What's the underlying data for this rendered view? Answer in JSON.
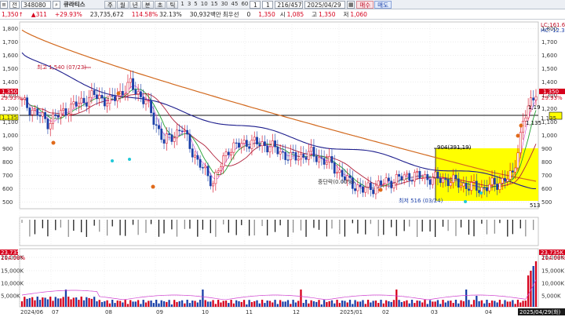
{
  "toolbar": {
    "menu_icon": "menu-icon",
    "mode": "전",
    "code": "348080",
    "search_icon": "search-icon",
    "name": "큐라티스",
    "periods": [
      "주",
      "월",
      "년",
      "분",
      "초",
      "틱"
    ],
    "intervals": [
      "1",
      "3",
      "5",
      "10",
      "15",
      "30",
      "45",
      "60",
      "1",
      "1"
    ],
    "page_counter": "216/457",
    "date": "2025/04/29",
    "calendar_icon": "calendar-icon",
    "buy_label": "매수",
    "sell_label": "매도"
  },
  "quote": {
    "price": "1,350",
    "change": "311",
    "change_pct": "+29.93%",
    "volume": "23,735,672",
    "vol_ratio": "114.58%",
    "turnover_rate": "32.13%",
    "amount": "30,932백만",
    "priority_label": "최우선",
    "priority_value": "0",
    "open_value": "1,350",
    "open_label": "시",
    "open_price": "1,085",
    "high_label": "고",
    "high_price": "1,350",
    "low_label": "저",
    "low_price": "1,060"
  },
  "chart_data": {
    "type": "candlestick",
    "y_ticks": [
      "1,800",
      "1,700",
      "1,600",
      "1,500",
      "1,400",
      "1,300",
      "1,200",
      "1,100",
      "1,000",
      "900",
      "800",
      "700",
      "600",
      "500"
    ],
    "y_range": [
      450,
      1850
    ],
    "x_ticks": [
      "2024/06",
      "07",
      "08",
      "09",
      "10",
      "11",
      "12",
      "2025/01",
      "02",
      "03",
      "04"
    ],
    "annotations": {
      "high": "최고 1,540 (07/23)",
      "low": "최저 516 (03/24)",
      "box": "904(391,19)",
      "halfway": "중단락(0.00%)",
      "right_1198": "1,19",
      "right_1135": "1,135",
      "right_513": "513",
      "top_lc": "LC:161.63",
      "top_hc": "HC:-12.34"
    },
    "left_labels": {
      "price_tag": "1,350",
      "change_tag": "29.93%",
      "cursor_tag": "1,135"
    },
    "right_labels": {
      "price_tag": "1,350",
      "change_tag": "29.93%",
      "cursor_tag": "1,135"
    },
    "reference_line": 1170,
    "volume_ticks": [
      "20,000K",
      "15,000K",
      "10,000K",
      "5,000K"
    ],
    "volume_left_tags": [
      "23,735K",
      "114.58%"
    ],
    "volume_right_tags": [
      "23,735K",
      "114.58%"
    ],
    "current_date_tag": "2025/04/29(화)",
    "colors": {
      "up": "#d6001c",
      "down": "#1a3fa8",
      "ma_orange": "#d2691e",
      "ma_navy": "#1c1c8c",
      "ma_red": "#b0203a",
      "ma_green": "#22a033",
      "box_fill": "#ffff00"
    }
  }
}
